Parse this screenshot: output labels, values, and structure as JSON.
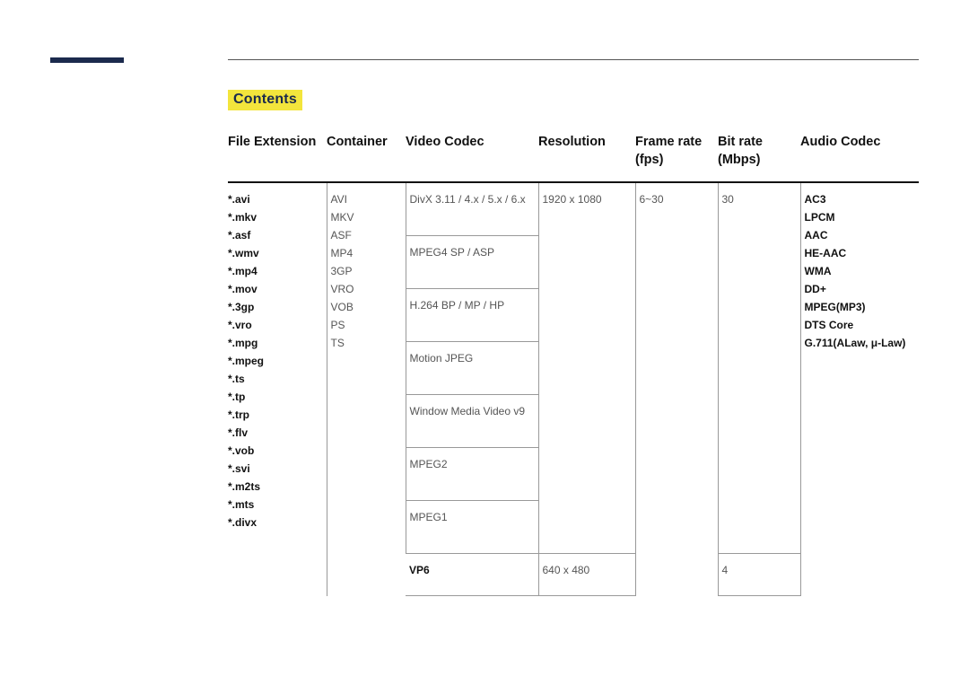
{
  "heading": "Contents",
  "columns": {
    "fileExtension": "File Extension",
    "container": "Container",
    "videoCodec": "Video Codec",
    "resolution": "Resolution",
    "frameRate": "Frame rate (fps)",
    "bitRate": "Bit rate (Mbps)",
    "audioCodec": "Audio Codec"
  },
  "fileExtensions": [
    "*.avi",
    "*.mkv",
    "*.asf",
    "*.wmv",
    "*.mp4",
    "*.mov",
    "*.3gp",
    "*.vro",
    "*.mpg",
    "*.mpeg",
    "*.ts",
    "*.tp",
    "*.trp",
    "*.flv",
    "*.vob",
    "*.svi",
    "*.m2ts",
    "*.mts",
    "*.divx"
  ],
  "containers": [
    "AVI",
    "MKV",
    "ASF",
    "MP4",
    "3GP",
    "VRO",
    "VOB",
    "PS",
    "TS"
  ],
  "videoCodecs": {
    "group1": [
      "DivX 3.11 / 4.x / 5.x / 6.x",
      "MPEG4 SP / ASP",
      "H.264 BP / MP / HP",
      "Motion JPEG",
      "Window Media Video v9",
      "MPEG2",
      "MPEG1"
    ],
    "vp6": "VP6"
  },
  "resolution": {
    "main": "1920 x 1080",
    "vp6": "640 x 480"
  },
  "frameRate": "6~30",
  "bitRate": {
    "main": "30",
    "vp6": "4"
  },
  "audioCodecs": [
    "AC3",
    "LPCM",
    "AAC",
    "HE-AAC",
    "WMA",
    "DD+",
    "MPEG(MP3)",
    "DTS Core",
    "G.711(ALaw, μ-Law)"
  ]
}
